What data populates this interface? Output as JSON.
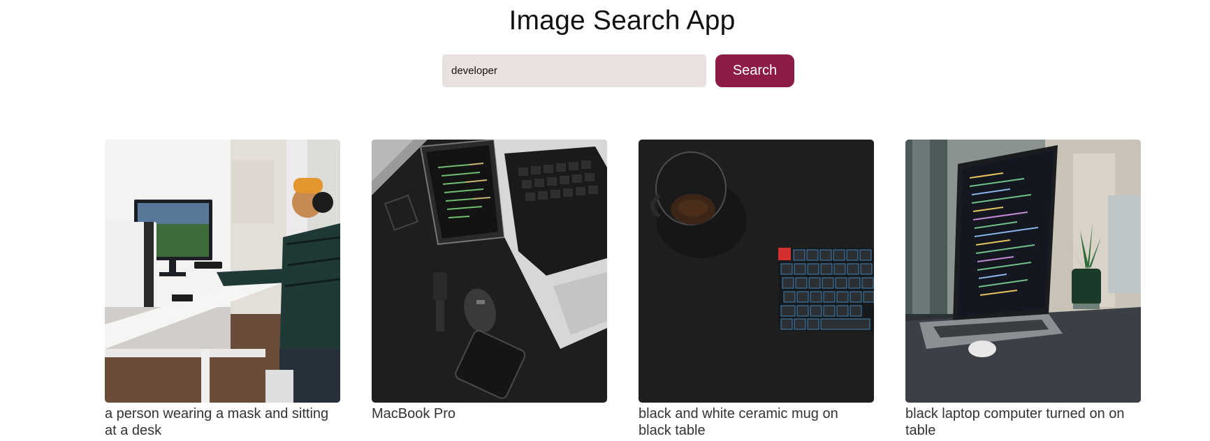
{
  "app": {
    "title": "Image Search App"
  },
  "search": {
    "value": "developer",
    "button_label": "Search"
  },
  "colors": {
    "accent": "#8c1c45",
    "input_background": "#e9e0df"
  },
  "results": [
    {
      "caption": "a person wearing a mask and sitting at a desk"
    },
    {
      "caption": "MacBook Pro"
    },
    {
      "caption": "black and white ceramic mug on black table"
    },
    {
      "caption": "black laptop computer turned on on table"
    }
  ]
}
